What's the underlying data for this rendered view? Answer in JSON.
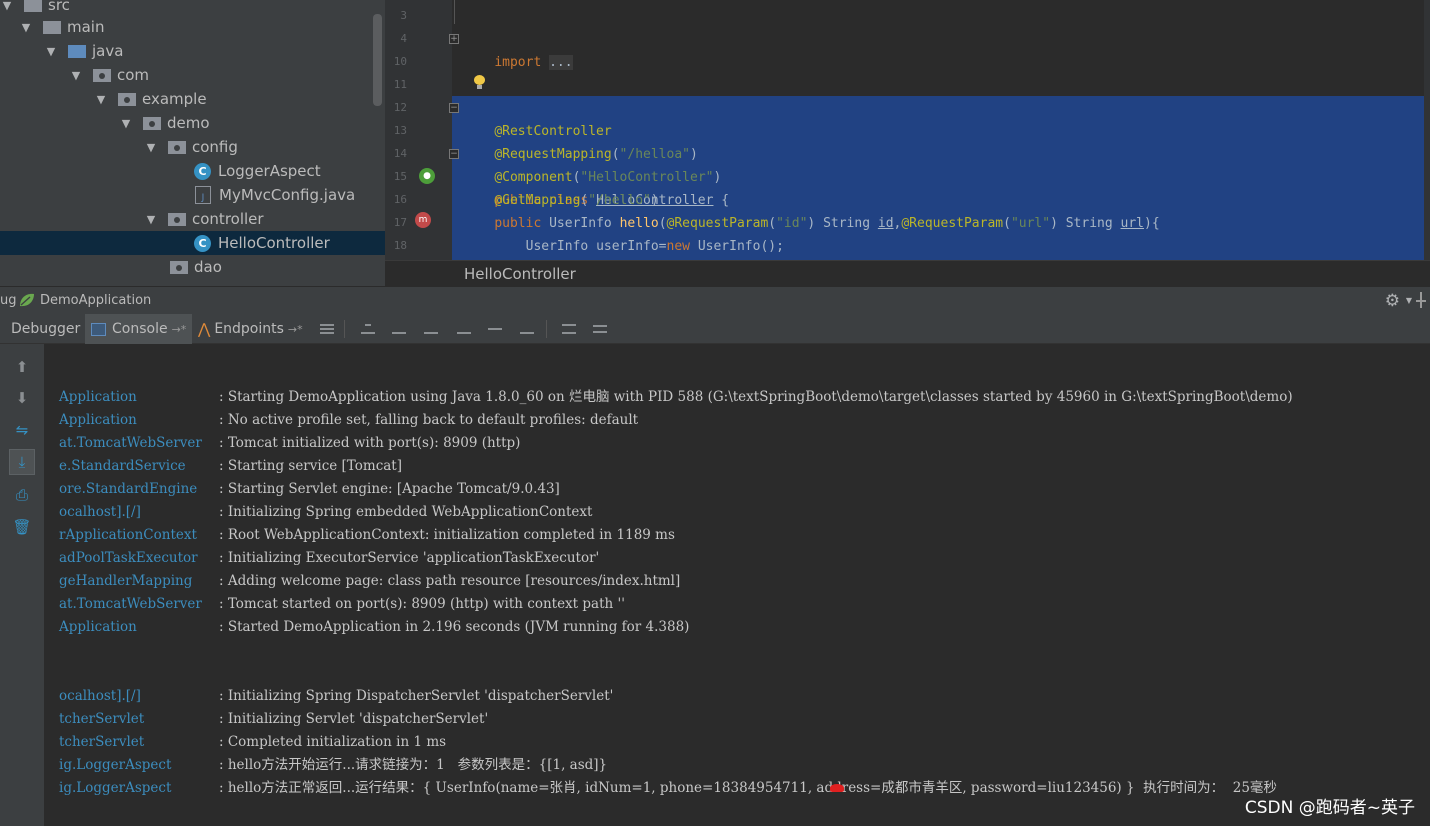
{
  "project_tree": {
    "items": [
      {
        "label": "src",
        "type": "folder-plain",
        "depth": 0,
        "expanded": true
      },
      {
        "label": "main",
        "type": "folder-plain",
        "depth": 1,
        "expanded": true
      },
      {
        "label": "java",
        "type": "folder-blue",
        "depth": 2,
        "expanded": true
      },
      {
        "label": "com",
        "type": "package",
        "depth": 3,
        "expanded": true
      },
      {
        "label": "example",
        "type": "package",
        "depth": 4,
        "expanded": true
      },
      {
        "label": "demo",
        "type": "package",
        "depth": 5,
        "expanded": true
      },
      {
        "label": "config",
        "type": "package",
        "depth": 6,
        "expanded": true
      },
      {
        "label": "LoggerAspect",
        "type": "class",
        "depth": 7
      },
      {
        "label": "MyMvcConfig.java",
        "type": "java-file",
        "depth": 7
      },
      {
        "label": "controller",
        "type": "package",
        "depth": 6,
        "expanded": true
      },
      {
        "label": "HelloController",
        "type": "class",
        "depth": 7,
        "selected": true
      },
      {
        "label": "dao",
        "type": "package",
        "depth": 6,
        "expanded": false
      }
    ]
  },
  "editor": {
    "line_numbers": [
      "3",
      "4",
      "10",
      "11",
      "12",
      "13",
      "14",
      "15",
      "16",
      "17",
      "18"
    ],
    "lines": {
      "import_kw": "import",
      "import_fold": "...",
      "l12": "@RestController",
      "l13_ann": "@RequestMapping",
      "l13_str": "\"/helloa\"",
      "l14_ann": "@Component",
      "l14_str": "\"HelloController\"",
      "l15_kw": "public class",
      "l15_name": "HelloController",
      "l15_brace": " {",
      "l16_ann": "@GetMapping",
      "l16_str": "\"/hello\"",
      "l17_kw": "public",
      "l17_type": " UserInfo ",
      "l17_name": "hello",
      "l17_ann1": "@RequestParam",
      "l17_str1": "\"id\"",
      "l17_p1": " String ",
      "l17_id": "id",
      "l17_ann2": "@RequestParam",
      "l17_str2": "\"url\"",
      "l17_p2": " String ",
      "l17_url": "url",
      "l17_end": "){",
      "l18_a": "UserInfo userInfo=",
      "l18_kw": "new",
      "l18_b": " UserInfo();"
    },
    "breadcrumb": "HelloController"
  },
  "debug": {
    "title_prefix": "ug",
    "title": "DemoApplication",
    "tabs": {
      "debugger": "Debugger",
      "console": "Console",
      "console_suffix": "→*",
      "endpoints": "Endpoints",
      "endpoints_suffix": "→*"
    }
  },
  "console": {
    "rows": [
      {
        "logger": "Application",
        "msg": ": Starting DemoApplication using Java 1.8.0_60 on 烂电脑 with PID 588 (G:\\textSpringBoot\\demo\\target\\classes started by 45960 in G:\\textSpringBoot\\demo)"
      },
      {
        "logger": "Application",
        "msg": ": No active profile set, falling back to default profiles: default"
      },
      {
        "logger": "at.TomcatWebServer",
        "msg": ": Tomcat initialized with port(s): 8909 (http)"
      },
      {
        "logger": "e.StandardService",
        "msg": ": Starting service [Tomcat]"
      },
      {
        "logger": "ore.StandardEngine",
        "msg": ": Starting Servlet engine: [Apache Tomcat/9.0.43]"
      },
      {
        "logger": "ocalhost].[/]",
        "msg": ": Initializing Spring embedded WebApplicationContext"
      },
      {
        "logger": "rApplicationContext",
        "msg": ": Root WebApplicationContext: initialization completed in 1189 ms"
      },
      {
        "logger": "adPoolTaskExecutor",
        "msg": ": Initializing ExecutorService 'applicationTaskExecutor'"
      },
      {
        "logger": "geHandlerMapping",
        "msg": ": Adding welcome page: class path resource [resources/index.html]"
      },
      {
        "logger": "at.TomcatWebServer",
        "msg": ": Tomcat started on port(s): 8909 (http) with context path ''"
      },
      {
        "logger": "Application",
        "msg": ": Started DemoApplication in 2.196 seconds (JVM running for 4.388)"
      },
      {
        "logger": "ocalhost].[/]",
        "msg": ": Initializing Spring DispatcherServlet 'dispatcherServlet'"
      },
      {
        "logger": "tcherServlet",
        "msg": ": Initializing Servlet 'dispatcherServlet'"
      },
      {
        "logger": "tcherServlet",
        "msg": ": Completed initialization in 1 ms"
      },
      {
        "logger": "ig.LoggerAspect",
        "msg": ": hello方法开始运行...请求链接为：1   参数列表是：{[1, asd]}"
      },
      {
        "logger": "ig.LoggerAspect",
        "msg": ": hello方法正常返回...运行结果：{ UserInfo(name=张肖, idNum=1, phone=18384954711, address=成都市青羊区, password=liu123456) }  执行时间为：  25毫秒"
      }
    ]
  },
  "watermark": "CSDN @跑码者~英子",
  "colors": {
    "selection": "#214283",
    "keyword": "#cc7832",
    "annotation": "#bbb529",
    "string": "#6a8759",
    "logger": "#3c8dbe"
  }
}
